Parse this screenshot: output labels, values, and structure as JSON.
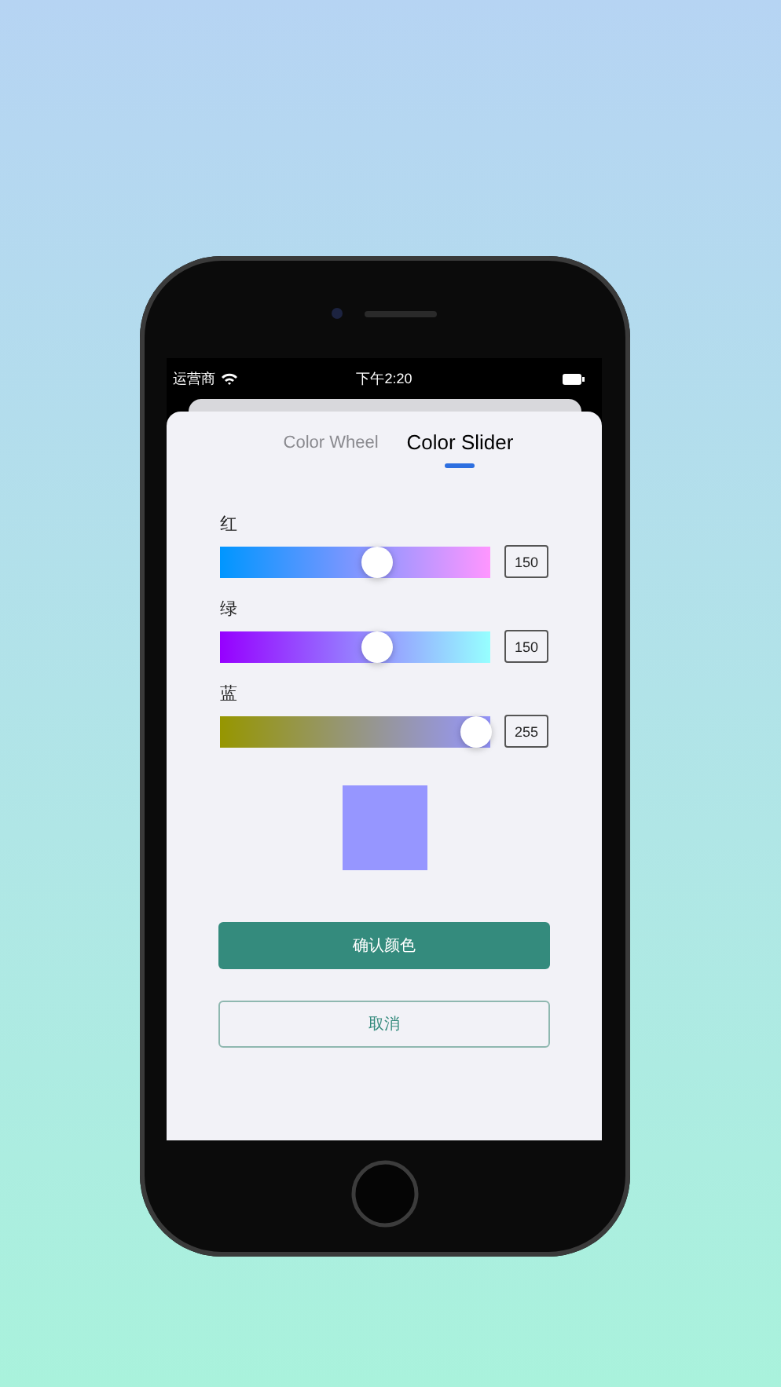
{
  "status_bar": {
    "carrier": "运营商",
    "time": "下午2:20"
  },
  "tabs": [
    {
      "label": "Color Wheel",
      "selected": false
    },
    {
      "label": "Color Slider",
      "selected": true
    }
  ],
  "sliders": [
    {
      "label": "红",
      "value": "150",
      "level": 0.588
    },
    {
      "label": "绿",
      "value": "150",
      "level": 0.588
    },
    {
      "label": "蓝",
      "value": "255",
      "level": 1
    }
  ],
  "buttons": [
    {
      "label": "确认颜色",
      "kind": "primary"
    },
    {
      "label": "取消",
      "kind": "outline"
    }
  ]
}
